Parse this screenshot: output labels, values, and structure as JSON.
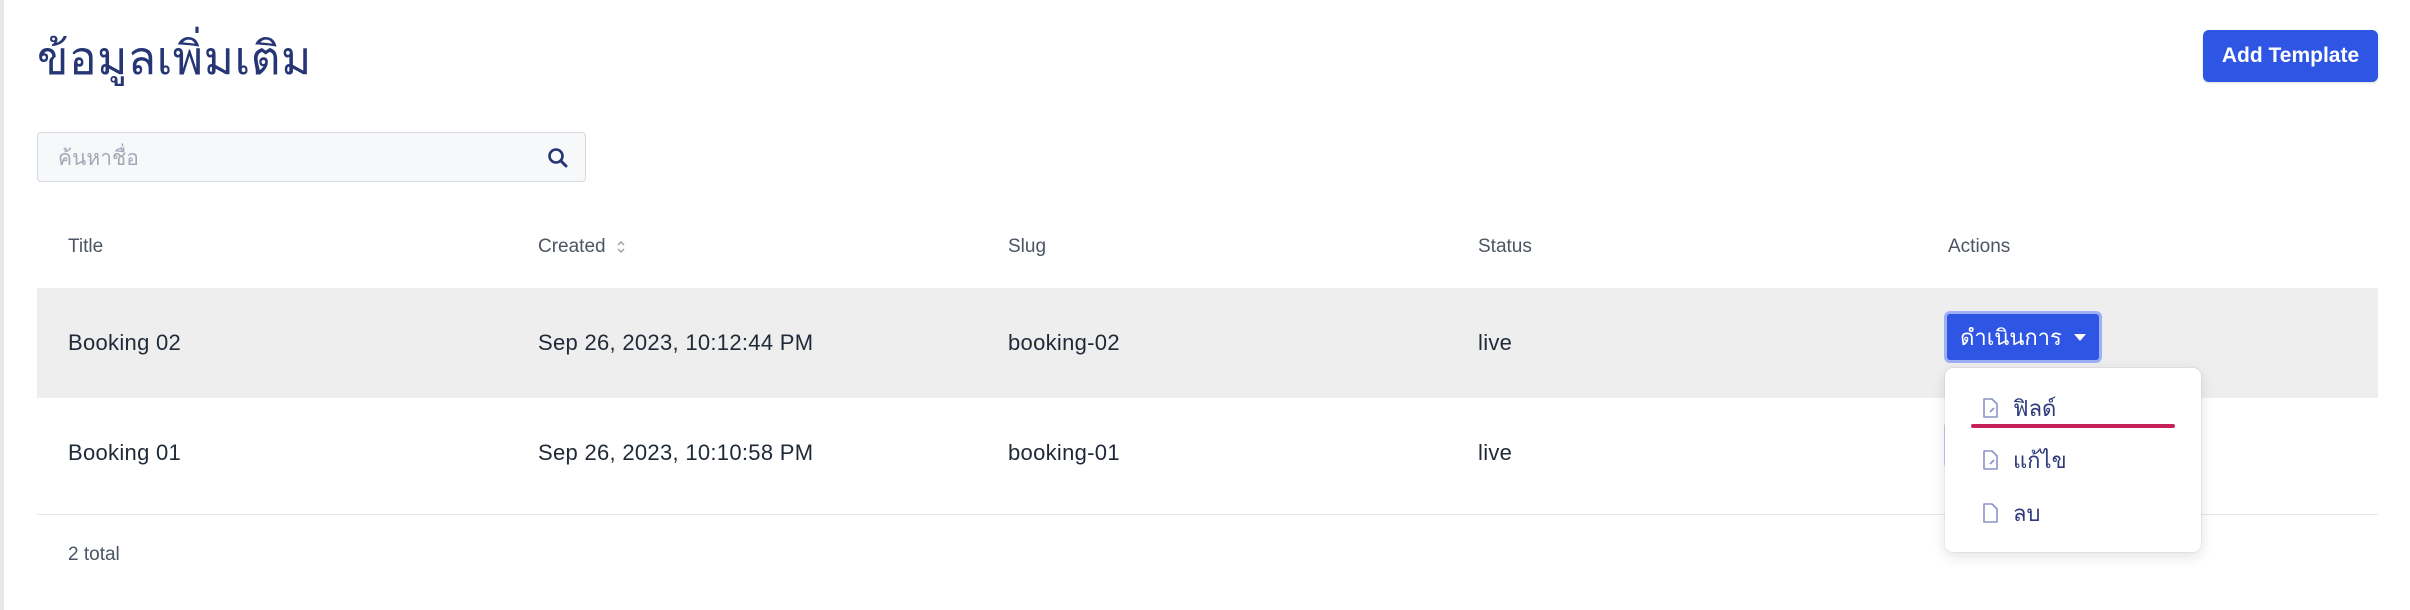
{
  "header": {
    "title": "ข้อมูลเพิ่มเติม",
    "add_button_label": "Add Template"
  },
  "search": {
    "placeholder": "ค้นหาชื่อ",
    "value": ""
  },
  "table": {
    "columns": [
      "Title",
      "Created",
      "Slug",
      "Status",
      "Actions"
    ],
    "rows": [
      {
        "title": "Booking 02",
        "created": "Sep 26, 2023, 10:12:44 PM",
        "slug": "booking-02",
        "status": "live"
      },
      {
        "title": "Booking 01",
        "created": "Sep 26, 2023, 10:10:58 PM",
        "slug": "booking-01",
        "status": "live"
      }
    ],
    "total": "2 total"
  },
  "actions": {
    "button_label": "ดำเนินการ",
    "menu": [
      {
        "label": "ฟิลด์",
        "icon": "document-icon"
      },
      {
        "label": "แก้ไข",
        "icon": "document-icon"
      },
      {
        "label": "ลบ",
        "icon": "document-icon"
      }
    ]
  },
  "colors": {
    "primary": "#2f55e4",
    "title": "#263574",
    "highlight_row": "#eeeeee",
    "menu_underline": "#c5225a"
  }
}
